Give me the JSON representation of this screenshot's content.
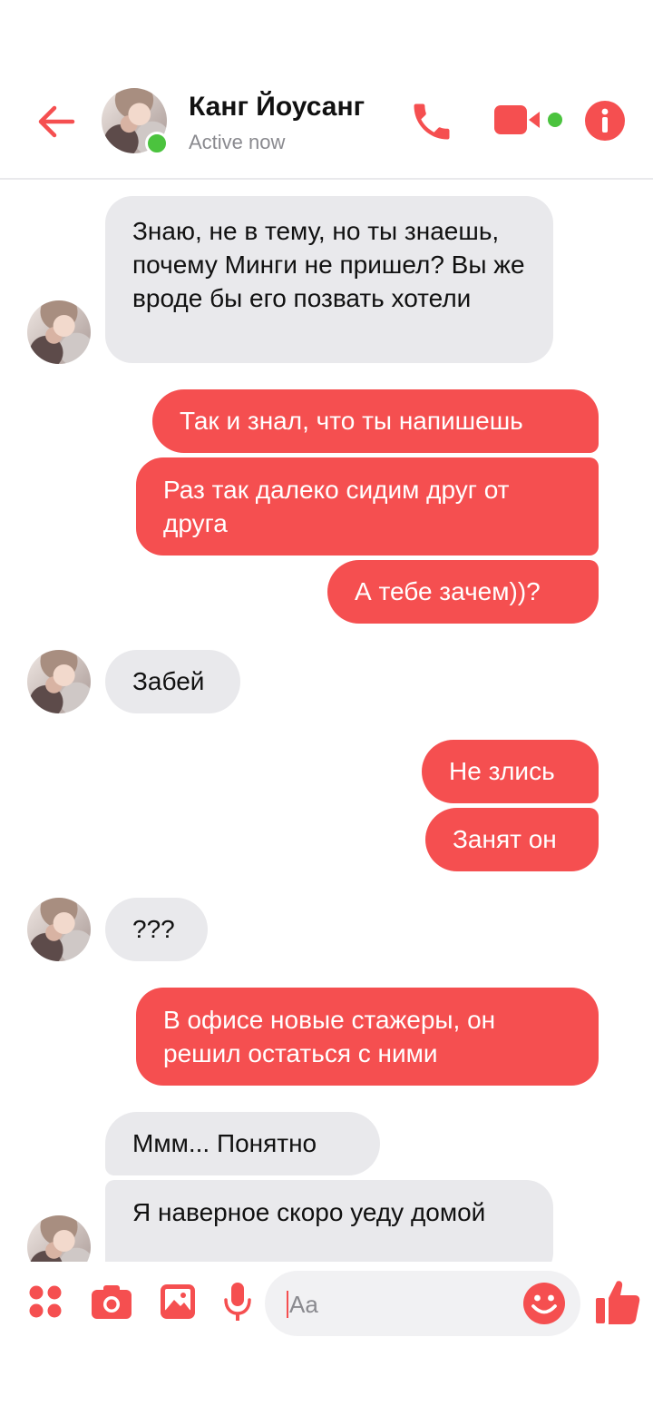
{
  "theme": {
    "accent": "#f54f50",
    "incoming_bubble": "#e9e9ec",
    "online": "#4bc33e"
  },
  "header": {
    "contact_name": "Канг Йоусанг",
    "status": "Active now",
    "icons": [
      "back-arrow-icon",
      "phone-icon",
      "video-camera-icon",
      "info-icon"
    ]
  },
  "messages": [
    {
      "from": "them",
      "text": "Знаю, не в тему, но ты знаешь, почему Минги не пришел? Вы же вроде бы его позвать хотели"
    },
    {
      "from": "me",
      "text": "Так и знал, что ты напишешь"
    },
    {
      "from": "me",
      "text": "Раз так далеко сидим друг от друга"
    },
    {
      "from": "me",
      "text": "А тебе зачем))?"
    },
    {
      "from": "them",
      "text": "Забей"
    },
    {
      "from": "me",
      "text": "Не злись"
    },
    {
      "from": "me",
      "text": "Занят он"
    },
    {
      "from": "them",
      "text": "???"
    },
    {
      "from": "me",
      "text": "В офисе новые стажеры, он решил остаться с ними"
    },
    {
      "from": "them",
      "text": "Ммм... Понятно"
    },
    {
      "from": "them",
      "text": "Я наверное скоро уеду домой"
    }
  ],
  "composer": {
    "placeholder": "Aa",
    "icons": [
      "apps-icon",
      "camera-icon",
      "gallery-icon",
      "microphone-icon",
      "emoji-icon",
      "thumbs-up-icon"
    ]
  }
}
